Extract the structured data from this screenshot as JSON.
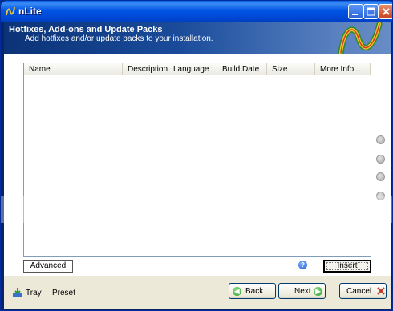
{
  "window": {
    "title": "nLite",
    "controls": {
      "minimize": "minimize",
      "maximize": "maximize",
      "close": "close"
    }
  },
  "header": {
    "title": "Hotfixes, Add-ons and Update Packs",
    "subtitle": "Add hotfixes and/or update packs to your installation."
  },
  "list": {
    "columns": [
      "Name",
      "Description",
      "Language",
      "Build Date",
      "Size",
      "More Info..."
    ],
    "rows": []
  },
  "panel": {
    "advanced_label": "Advanced",
    "help_icon": "?",
    "insert_label": "Insert",
    "side_buttons": [
      "move-up-icon",
      "move-down-icon",
      "move-first-icon",
      "move-last-icon"
    ]
  },
  "footer": {
    "tray_label": "Tray",
    "preset_label": "Preset",
    "back_label": "Back",
    "next_label": "Next",
    "cancel_label": "Cancel"
  },
  "colors": {
    "titlebar": "#0054e3",
    "banner_dark": "#0b3377",
    "face": "#ece9d8",
    "nav_green": "#2b9b2b",
    "cancel_x": "#c0392b"
  }
}
